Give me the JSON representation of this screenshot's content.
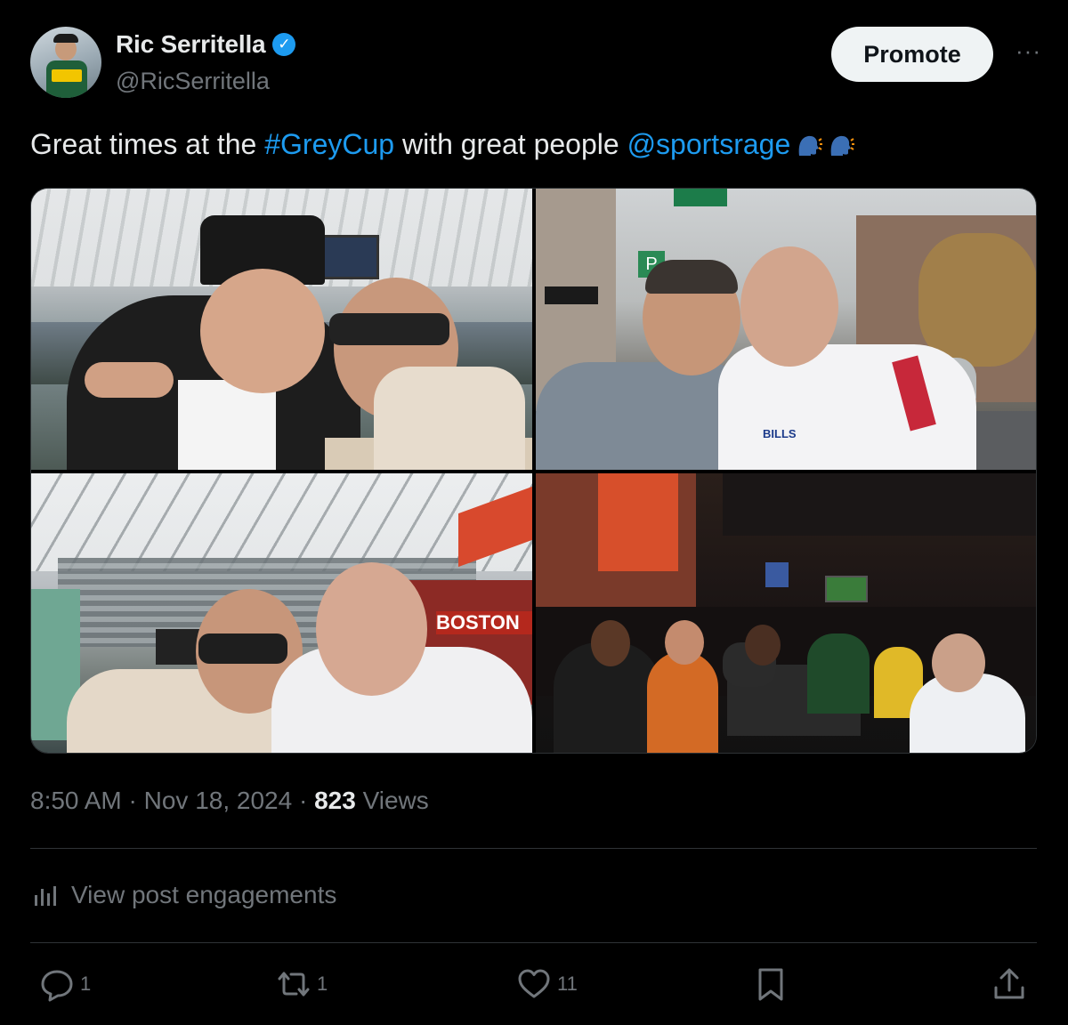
{
  "author": {
    "display_name": "Ric Serritella",
    "handle": "@RicSerritella",
    "verified_icon": "verified-badge-icon",
    "avatar_icon": "avatar-photo"
  },
  "header": {
    "promote_label": "Promote",
    "more_label": "···"
  },
  "tweet": {
    "text_before_hashtag": "Great times at the ",
    "hashtag": "#GreyCup",
    "text_between": " with great people ",
    "mention": "@sportsrage",
    "emoji": [
      "speaking-head-emoji",
      "speaking-head-emoji"
    ]
  },
  "photos": [
    {
      "name": "stadium-selfie-photo"
    },
    {
      "name": "street-selfie-photo"
    },
    {
      "name": "stadium-exterior-selfie-photo"
    },
    {
      "name": "restaurant-group-photo"
    }
  ],
  "meta": {
    "time": "8:50 AM",
    "separator": " · ",
    "date": "Nov 18, 2024",
    "separator2": " · ",
    "views_count": "823",
    "views_label": " Views"
  },
  "engagements": {
    "label": "View post engagements",
    "icon": "analytics-icon"
  },
  "actions": {
    "reply_count": "1",
    "repost_count": "1",
    "like_count": "11"
  },
  "colors": {
    "background": "#000000",
    "link": "#1d9bf0",
    "secondary_text": "#71767b",
    "primary_text": "#e7e9ea"
  }
}
